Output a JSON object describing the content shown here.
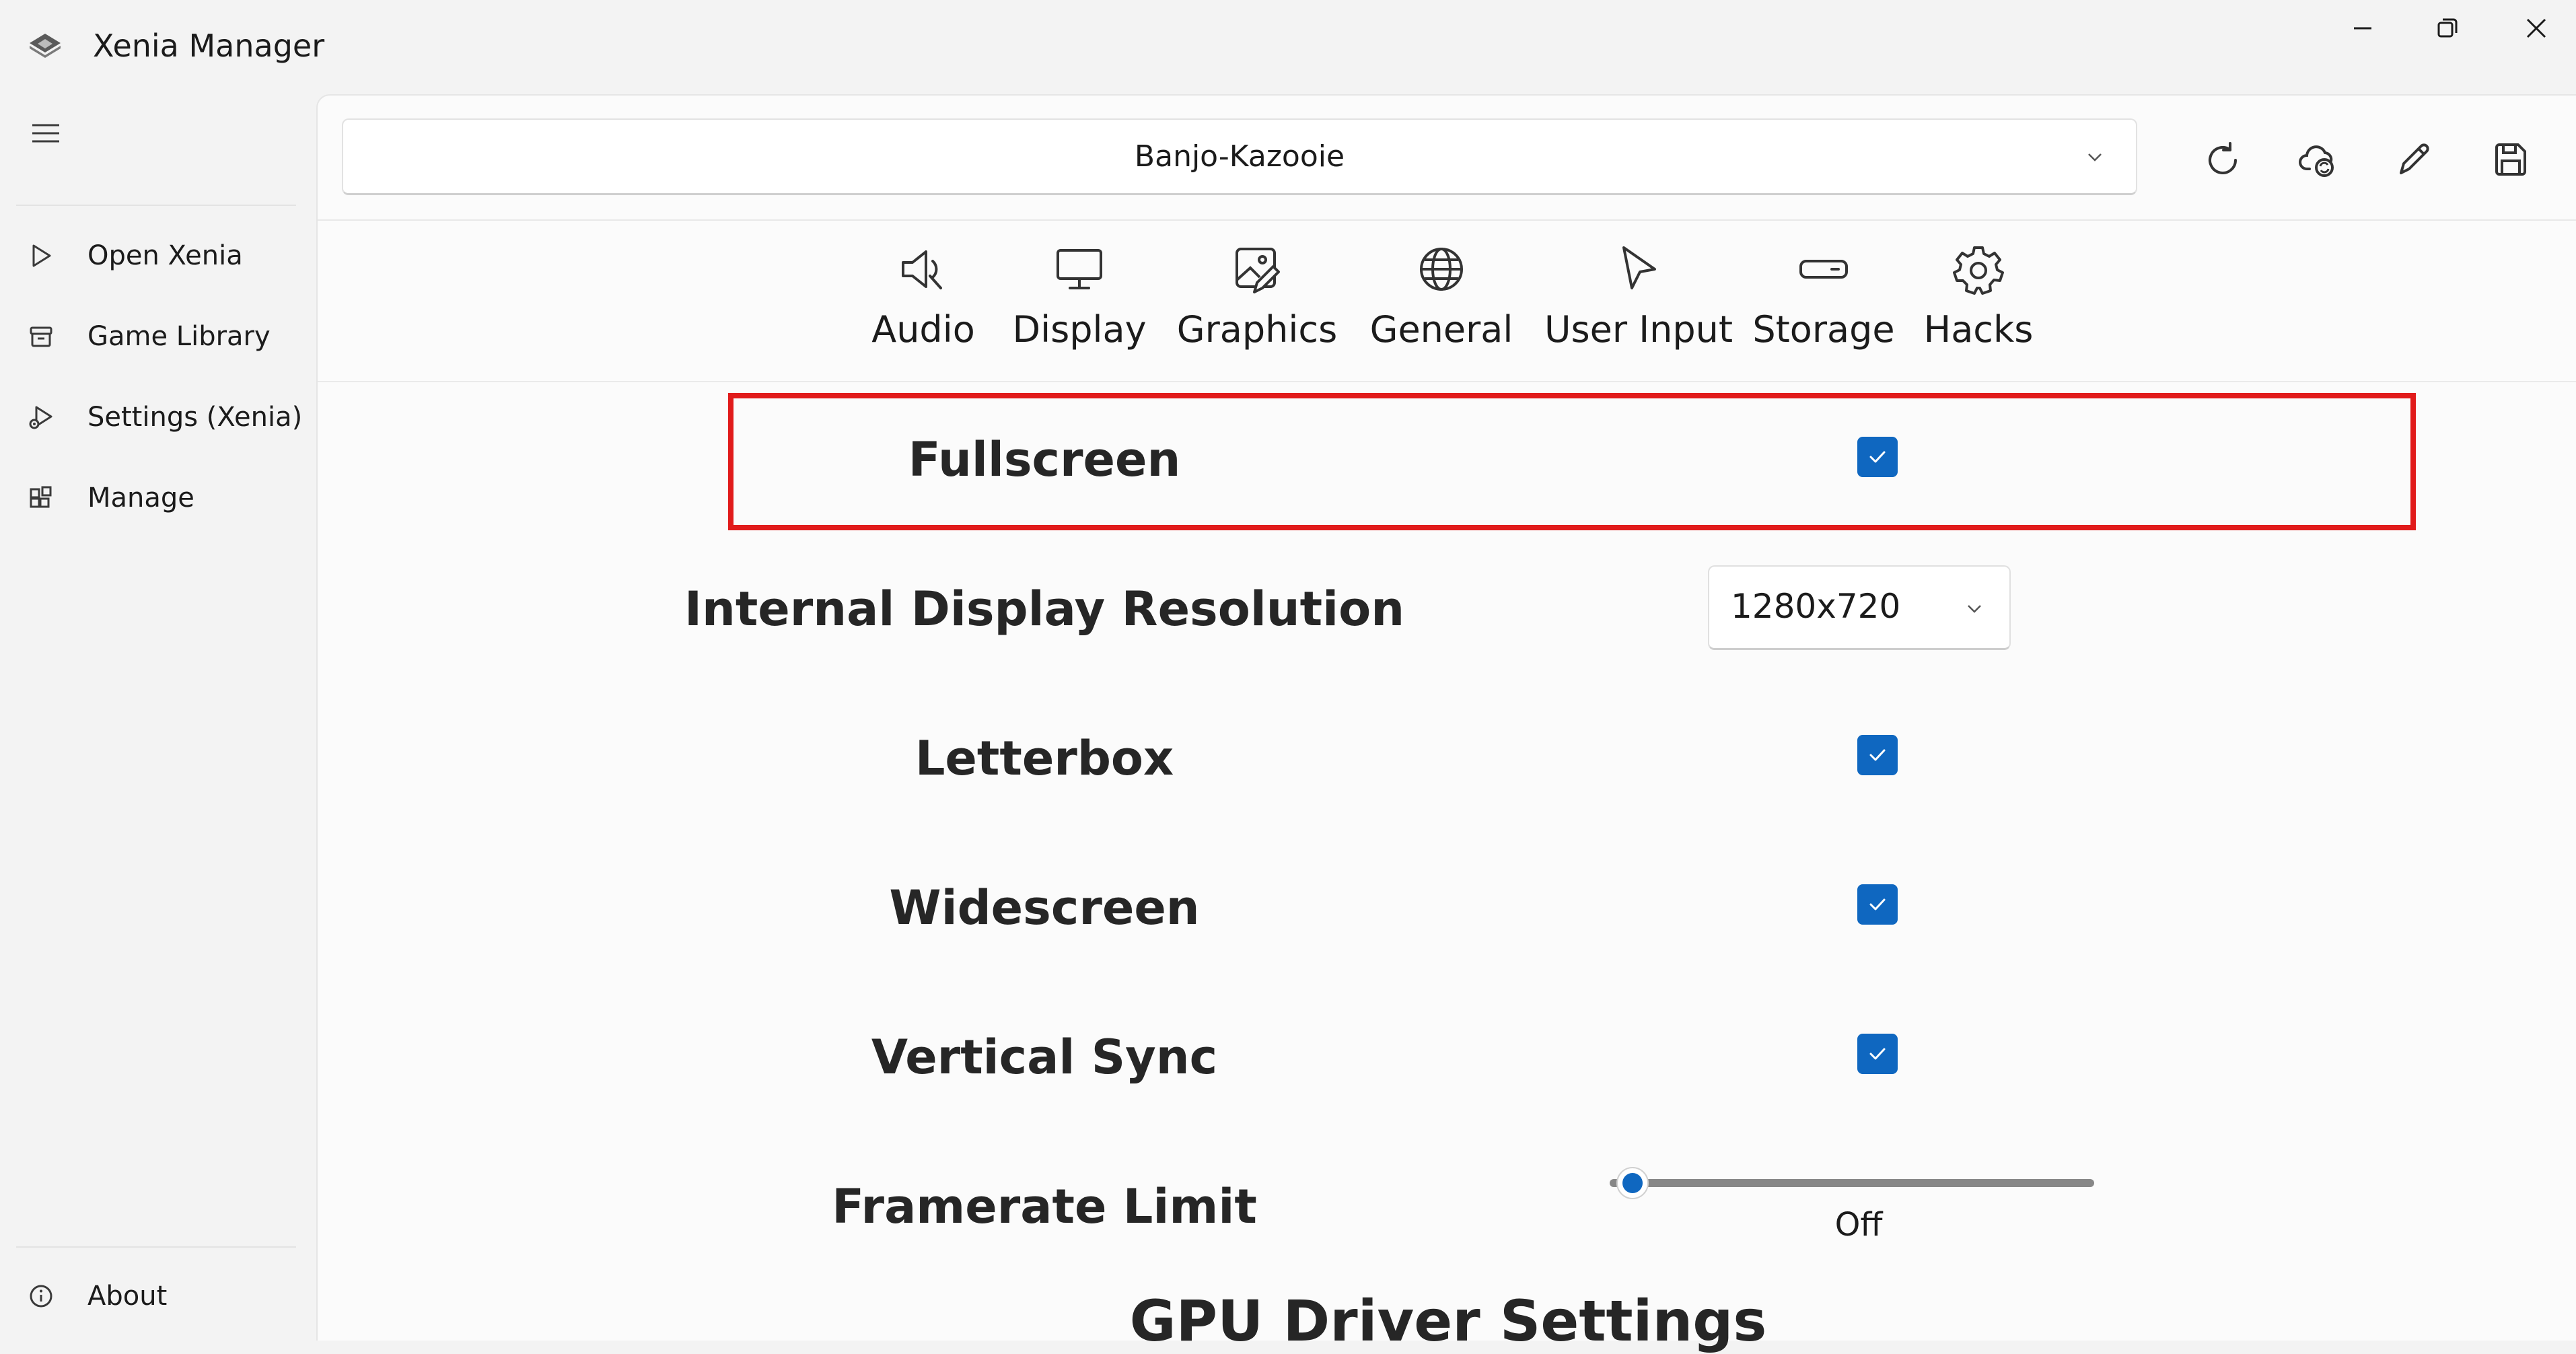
{
  "window": {
    "title": "Xenia Manager",
    "icon": "xenia-logo-icon",
    "controls": [
      "minimize-icon",
      "restore-icon",
      "close-icon"
    ]
  },
  "nav": {
    "menu_icon": "hamburger-icon",
    "items": [
      {
        "label": "Open Xenia",
        "icon": "play-icon"
      },
      {
        "label": "Game Library",
        "icon": "archive-icon"
      },
      {
        "label": "Settings (Xenia)",
        "icon": "settings-play-icon"
      },
      {
        "label": "Manage",
        "icon": "apps-icon"
      }
    ],
    "footer": {
      "label": "About",
      "icon": "info-icon"
    }
  },
  "header": {
    "game_select": {
      "value": "Banjo-Kazooie"
    },
    "toolbar": [
      "refresh-icon",
      "cloud-sync-icon",
      "edit-icon",
      "save-icon"
    ]
  },
  "tabs": [
    {
      "label": "Audio",
      "icon": "speaker-icon"
    },
    {
      "label": "Display",
      "icon": "monitor-icon"
    },
    {
      "label": "Graphics",
      "icon": "image-edit-icon"
    },
    {
      "label": "General",
      "icon": "globe-icon"
    },
    {
      "label": "User Input",
      "icon": "cursor-icon"
    },
    {
      "label": "Storage",
      "icon": "storage-icon"
    },
    {
      "label": "Hacks",
      "icon": "gear-icon"
    }
  ],
  "settings": {
    "fullscreen": {
      "label": "Fullscreen",
      "checked": true
    },
    "internal_resolution": {
      "label": "Internal Display Resolution",
      "value": "1280x720"
    },
    "letterbox": {
      "label": "Letterbox",
      "checked": true
    },
    "widescreen": {
      "label": "Widescreen",
      "checked": true
    },
    "vsync": {
      "label": "Vertical Sync",
      "checked": true
    },
    "framerate_limit": {
      "label": "Framerate Limit",
      "value_text": "Off",
      "value": 0
    }
  },
  "section": {
    "title": "GPU Driver Settings"
  },
  "colors": {
    "accent": "#0f67c0",
    "highlight": "#e11b1b",
    "background": "#f3f3f3",
    "panel": "#fbfbfb"
  }
}
